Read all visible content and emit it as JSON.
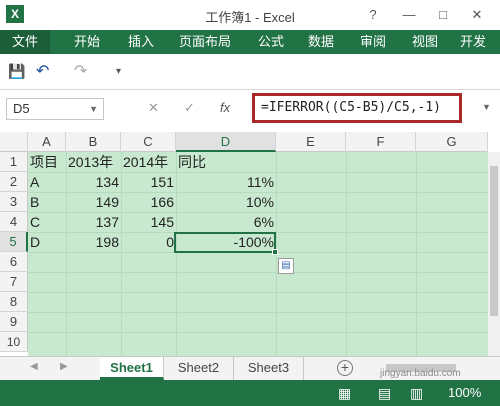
{
  "window": {
    "title": "工作簿1 - Excel",
    "help": "?",
    "minimize": "—",
    "restore": "□",
    "close": "✕"
  },
  "app_icon": "X",
  "ribbon": {
    "tabs": [
      "文件",
      "开始",
      "插入",
      "页面布局",
      "公式",
      "数据",
      "审阅",
      "视图",
      "开发"
    ]
  },
  "qat": {
    "save": "💾",
    "undo": "↶",
    "redo": "↷",
    "customize": "▾"
  },
  "formula_bar": {
    "name_box": "D5",
    "cancel": "✕",
    "enter": "✓",
    "fx": "fx",
    "formula": "=IFERROR((C5-B5)/C5,-1)"
  },
  "grid": {
    "columns": [
      "A",
      "B",
      "C",
      "D",
      "E",
      "F",
      "G"
    ],
    "rows": [
      "1",
      "2",
      "3",
      "4",
      "5",
      "6",
      "7",
      "8",
      "9",
      "10"
    ],
    "active_cell": "D5",
    "cells": {
      "A1": "项目",
      "B1": "2013年",
      "C1": "2014年",
      "D1": "同比",
      "A2": "A",
      "B2": "134",
      "C2": "151",
      "D2": "11%",
      "A3": "B",
      "B3": "149",
      "C3": "166",
      "D3": "10%",
      "A4": "C",
      "B4": "137",
      "C4": "145",
      "D4": "6%",
      "A5": "D",
      "B5": "198",
      "C5": "0",
      "D5": "-100%"
    }
  },
  "sheets": {
    "tabs": [
      "Sheet1",
      "Sheet2",
      "Sheet3"
    ],
    "active": "Sheet1",
    "add": "+"
  },
  "status_bar": {
    "zoom": "100%"
  },
  "watermark": "jingyan.baidu.com",
  "colors": {
    "excel_green": "#217346",
    "cell_fill": "#c8e9cf",
    "highlight_box": "#a8282b"
  }
}
